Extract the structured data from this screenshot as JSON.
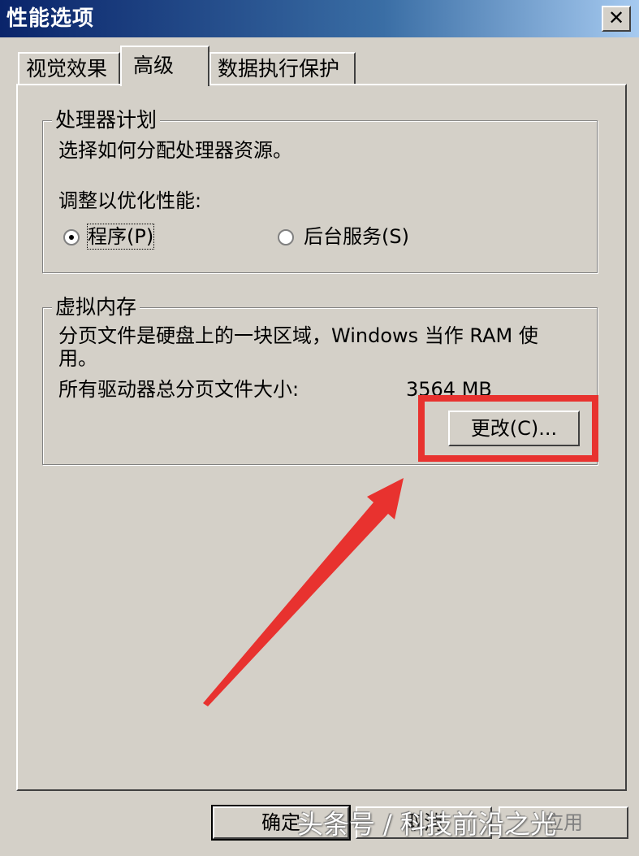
{
  "window": {
    "title": "性能选项",
    "close_glyph": "✕"
  },
  "tabs": [
    {
      "label": "视觉效果",
      "active": false
    },
    {
      "label": "高级",
      "active": true
    },
    {
      "label": "数据执行保护",
      "active": false
    }
  ],
  "processor": {
    "legend": "处理器计划",
    "description": "选择如何分配处理器资源。",
    "adjust_label": "调整以优化性能:",
    "options": [
      {
        "label": "程序(P)",
        "selected": true
      },
      {
        "label": "后台服务(S)",
        "selected": false
      }
    ]
  },
  "virtual_memory": {
    "legend": "虚拟内存",
    "description_line1": "分页文件是硬盘上的一块区域，Windows 当作 RAM 使",
    "description_line2": "用。",
    "total_label": "所有驱动器总分页文件大小:",
    "total_value": "3564 MB",
    "change_button": "更改(C)..."
  },
  "footer": {
    "ok_button": "确定",
    "cancel_button": "取消",
    "apply_button": "应用"
  },
  "overlay": {
    "highlight_color": "#e8322f",
    "arrow_color": "#e8322f",
    "watermark": "头条号 / 科技前沿之光"
  }
}
